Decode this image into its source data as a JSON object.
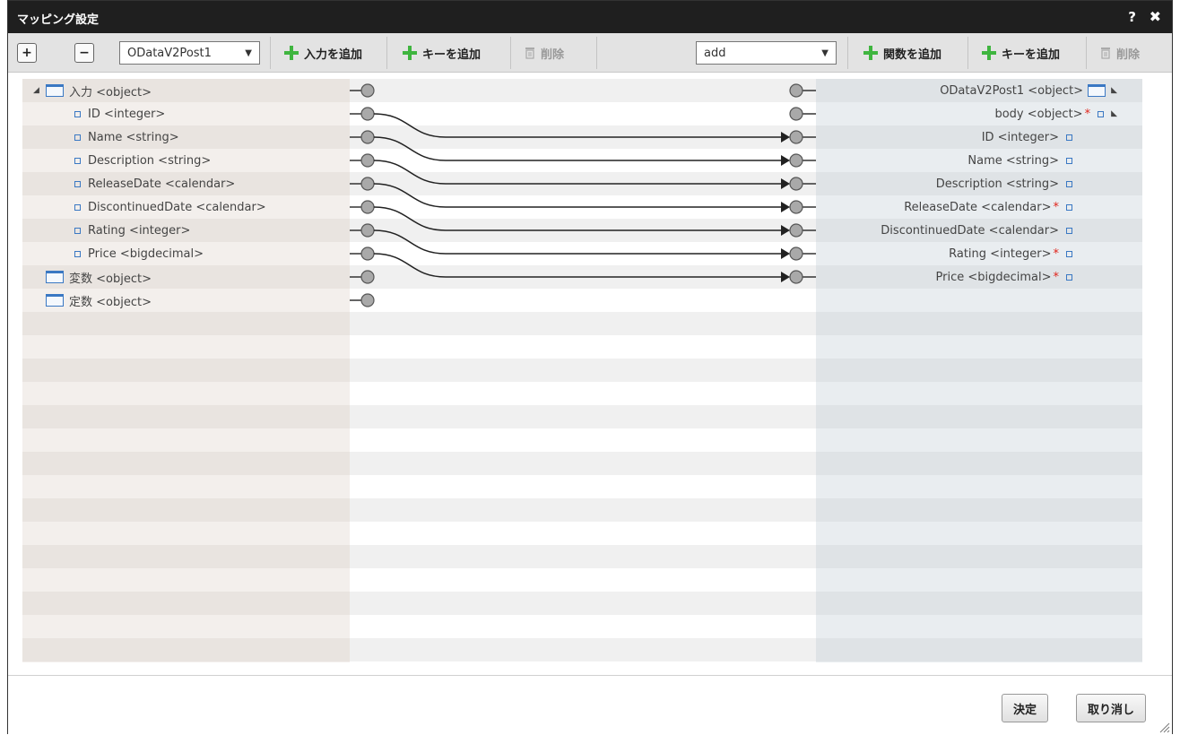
{
  "dialog": {
    "title": "マッピング設定",
    "help_label": "?",
    "close_label": "✖"
  },
  "toolbar": {
    "expand_label": "+",
    "collapse_label": "−",
    "source_select_value": "ODataV2Post1",
    "add_input_label": "入力を追加",
    "add_key_left_label": "キーを追加",
    "delete_left_label": "削除",
    "function_select_value": "add",
    "add_function_label": "関数を追加",
    "add_key_right_label": "キーを追加",
    "delete_right_label": "削除"
  },
  "left_tree": [
    {
      "label": "入力 <object>",
      "kind": "object",
      "expanded": true
    },
    {
      "label": "ID <integer>",
      "kind": "field"
    },
    {
      "label": "Name <string>",
      "kind": "field"
    },
    {
      "label": "Description <string>",
      "kind": "field"
    },
    {
      "label": "ReleaseDate <calendar>",
      "kind": "field"
    },
    {
      "label": "DiscontinuedDate <calendar>",
      "kind": "field"
    },
    {
      "label": "Rating <integer>",
      "kind": "field"
    },
    {
      "label": "Price <bigdecimal>",
      "kind": "field"
    },
    {
      "label": "変数 <object>",
      "kind": "object"
    },
    {
      "label": "定数 <object>",
      "kind": "object"
    }
  ],
  "right_tree": [
    {
      "label": "ODataV2Post1 <object>",
      "kind": "object",
      "required": false
    },
    {
      "label": "body <object>",
      "kind": "field",
      "required": true
    },
    {
      "label": "ID <integer>",
      "kind": "field",
      "required": false
    },
    {
      "label": "Name <string>",
      "kind": "field",
      "required": false
    },
    {
      "label": "Description <string>",
      "kind": "field",
      "required": false
    },
    {
      "label": "ReleaseDate <calendar>",
      "kind": "field",
      "required": true
    },
    {
      "label": "DiscontinuedDate <calendar>",
      "kind": "field",
      "required": false
    },
    {
      "label": "Rating <integer>",
      "kind": "field",
      "required": true
    },
    {
      "label": "Price <bigdecimal>",
      "kind": "field",
      "required": true
    }
  ],
  "mappings": [
    {
      "from": 1,
      "to": 2
    },
    {
      "from": 2,
      "to": 3
    },
    {
      "from": 3,
      "to": 4
    },
    {
      "from": 4,
      "to": 5
    },
    {
      "from": 5,
      "to": 6
    },
    {
      "from": 6,
      "to": 7
    },
    {
      "from": 7,
      "to": 8
    }
  ],
  "footer": {
    "ok_label": "決定",
    "cancel_label": "取り消し"
  },
  "colors": {
    "accent_green": "#3fb53f",
    "required_red": "#e0241b",
    "icon_blue": "#3a78c3",
    "titlebar": "#1f1f1f"
  }
}
